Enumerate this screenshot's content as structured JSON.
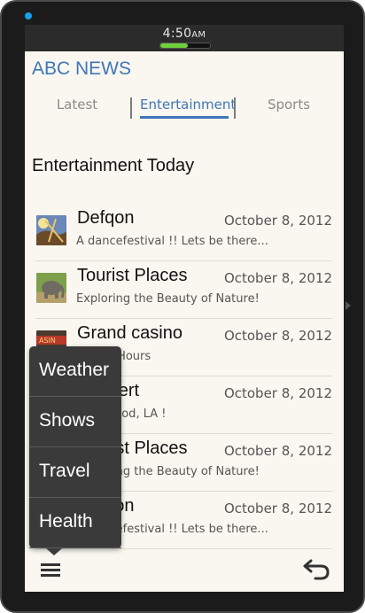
{
  "status_bar": {
    "time": "4:50",
    "ampm": "AM",
    "battery_level": 0.55
  },
  "app": {
    "title": "ABC NEWS"
  },
  "tabs": [
    {
      "label": "Latest"
    },
    {
      "label": "Entertainment",
      "active": true
    },
    {
      "label": "Sports"
    }
  ],
  "section_title": "Entertainment Today",
  "news_items": [
    {
      "title": "Defqon",
      "date": "October 8, 2012",
      "subtitle": "A dancefestival !! Lets be there...",
      "thumb_icon": "festival-photo-icon"
    },
    {
      "title": "Tourist Places",
      "date": "October 8, 2012",
      "subtitle": "Exploring the Beauty of Nature!",
      "thumb_icon": "elephant-photo-icon"
    },
    {
      "title": "Grand casino",
      "date": "October 8, 2012",
      "subtitle": "Happy Hours",
      "thumb_icon": "casino-photo-icon"
    },
    {
      "title": "Concert",
      "date": "October 8, 2012",
      "subtitle": "Hollywood, LA !",
      "thumb_icon": "concert-photo-icon"
    },
    {
      "title": "Tourist Places",
      "date": "October 8, 2012",
      "subtitle": "Exploring the Beauty of Nature!",
      "thumb_icon": "elephant-photo-icon"
    },
    {
      "title": "Defqon",
      "date": "October 8, 2012",
      "subtitle": "A dancefestival !! Lets be there...",
      "thumb_icon": "festival-photo-icon"
    }
  ],
  "popup_menu": {
    "items": [
      {
        "label": "Weather"
      },
      {
        "label": "Shows"
      },
      {
        "label": "Travel"
      },
      {
        "label": "Health"
      }
    ]
  },
  "bottom_bar": {
    "menu_icon": "hamburger-menu-icon",
    "back_icon": "back-arrow-icon"
  },
  "colors": {
    "accent": "#3f76b8",
    "screen_bg": "#f9f7f0",
    "popup_bg": "#3a3a3a",
    "battery": "#6fcf3a"
  }
}
